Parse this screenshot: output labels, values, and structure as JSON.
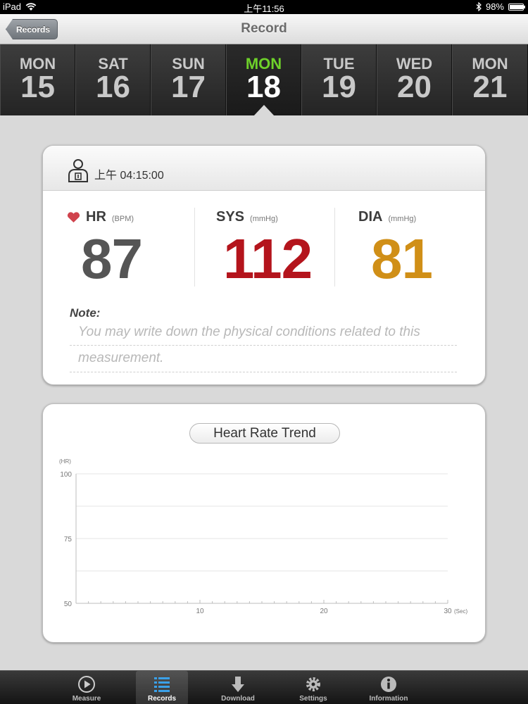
{
  "status_bar": {
    "device": "iPad",
    "time": "上午11:56",
    "battery": "98%",
    "battery_level": 0.98
  },
  "nav": {
    "back_label": "Records",
    "title": "Record"
  },
  "days": [
    {
      "name": "MON",
      "num": "15",
      "selected": false
    },
    {
      "name": "SAT",
      "num": "16",
      "selected": false
    },
    {
      "name": "SUN",
      "num": "17",
      "selected": false
    },
    {
      "name": "MON",
      "num": "18",
      "selected": true
    },
    {
      "name": "TUE",
      "num": "19",
      "selected": false
    },
    {
      "name": "WED",
      "num": "20",
      "selected": false
    },
    {
      "name": "MON",
      "num": "21",
      "selected": false
    }
  ],
  "record": {
    "time": "上午 04:15:00",
    "hr": {
      "label": "HR",
      "unit": "(BPM)",
      "value": "87",
      "color": "#555555"
    },
    "sys": {
      "label": "SYS",
      "unit": "(mmHg)",
      "value": "112",
      "color": "#b4141c"
    },
    "dia": {
      "label": "DIA",
      "unit": "(mmHg)",
      "value": "81",
      "color": "#d08f17"
    },
    "note_label": "Note:",
    "note_placeholder_line1": "You may write down the physical conditions related to this",
    "note_placeholder_line2": "measurement."
  },
  "trend": {
    "title": "Heart Rate Trend"
  },
  "chart_data": {
    "type": "line",
    "title": "Heart Rate Trend",
    "ylabel": "(HR)",
    "xlabel": "(Sec)",
    "xlim": [
      0,
      30
    ],
    "ylim": [
      50,
      100
    ],
    "y_ticks": [
      100,
      75,
      50
    ],
    "x_ticks": [
      10,
      20,
      30
    ],
    "grid": true,
    "series": []
  },
  "tabs": [
    {
      "label": "Measure",
      "icon": "play-circle-icon",
      "active": false
    },
    {
      "label": "Records",
      "icon": "list-icon",
      "active": true
    },
    {
      "label": "Download",
      "icon": "download-arrow-icon",
      "active": false
    },
    {
      "label": "Settings",
      "icon": "gear-icon",
      "active": false
    },
    {
      "label": "Information",
      "icon": "info-icon",
      "active": false
    }
  ],
  "colors": {
    "selected_day": "#6ed12a",
    "heart": "#d0434d"
  }
}
